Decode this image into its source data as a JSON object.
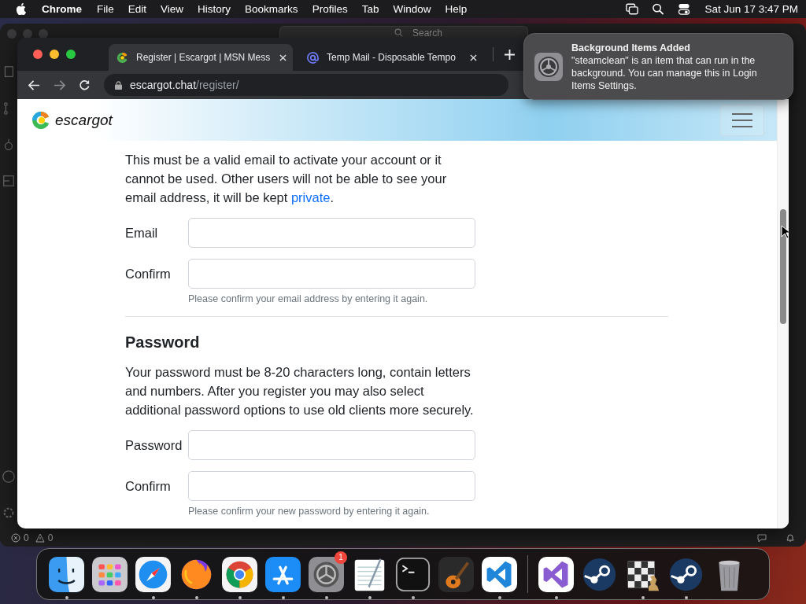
{
  "menubar": {
    "app": "Chrome",
    "menus": [
      "File",
      "Edit",
      "View",
      "History",
      "Bookmarks",
      "Profiles",
      "Tab",
      "Window",
      "Help"
    ],
    "clock": "Sat Jun 17  3:47 PM"
  },
  "background_window": {
    "search": {
      "placeholder": "Search"
    },
    "status_bar": {
      "errors": "0",
      "warnings": "0"
    }
  },
  "browser": {
    "tabs": [
      {
        "title": "Register | Escargot | MSN Mess",
        "selected": true,
        "kind": "escargot"
      },
      {
        "title": "Temp Mail - Disposable Tempo",
        "selected": false,
        "kind": "at"
      }
    ],
    "address": {
      "host": "escargot.chat",
      "path": "/register/"
    }
  },
  "page": {
    "brand": "escargot",
    "email_note": {
      "before": "This must be a valid email to activate your account or it cannot be used. Other users will not be able to see your email address, it will be kept ",
      "link": "private",
      "after": "."
    },
    "email_fields": [
      {
        "label": "Email"
      },
      {
        "label": "Confirm",
        "hint": "Please confirm your email address by entering it again."
      }
    ],
    "password_heading": "Password",
    "password_note": "Your password must be 8-20 characters long, contain letters and numbers. After you register you may also select additional password options to use old clients more securely.",
    "password_fields": [
      {
        "label": "Password"
      },
      {
        "label": "Confirm",
        "hint": "Please confirm your new password by entering it again."
      }
    ]
  },
  "notification": {
    "title": "Background Items Added",
    "body": "\"steamclean\" is an item that can run in the background. You can manage this in Login Items Settings."
  },
  "dock": {
    "apps": [
      {
        "kind": "finder",
        "running": true
      },
      {
        "kind": "launchpad",
        "running": false
      },
      {
        "kind": "safari",
        "running": true
      },
      {
        "kind": "firefox",
        "running": true
      },
      {
        "kind": "chrome",
        "running": true
      },
      {
        "kind": "appstore",
        "running": true
      },
      {
        "kind": "settings",
        "running": true,
        "badge": "1"
      },
      {
        "kind": "textedit",
        "running": true
      },
      {
        "kind": "terminal",
        "running": true
      },
      {
        "kind": "garageband",
        "running": false
      },
      {
        "kind": "vscode",
        "running": true
      }
    ],
    "others": [
      {
        "kind": "visualstudio",
        "running": true
      },
      {
        "kind": "steam",
        "running": false
      },
      {
        "kind": "chess",
        "running": true
      },
      {
        "kind": "steam",
        "running": true
      },
      {
        "kind": "trash",
        "running": false
      }
    ]
  }
}
